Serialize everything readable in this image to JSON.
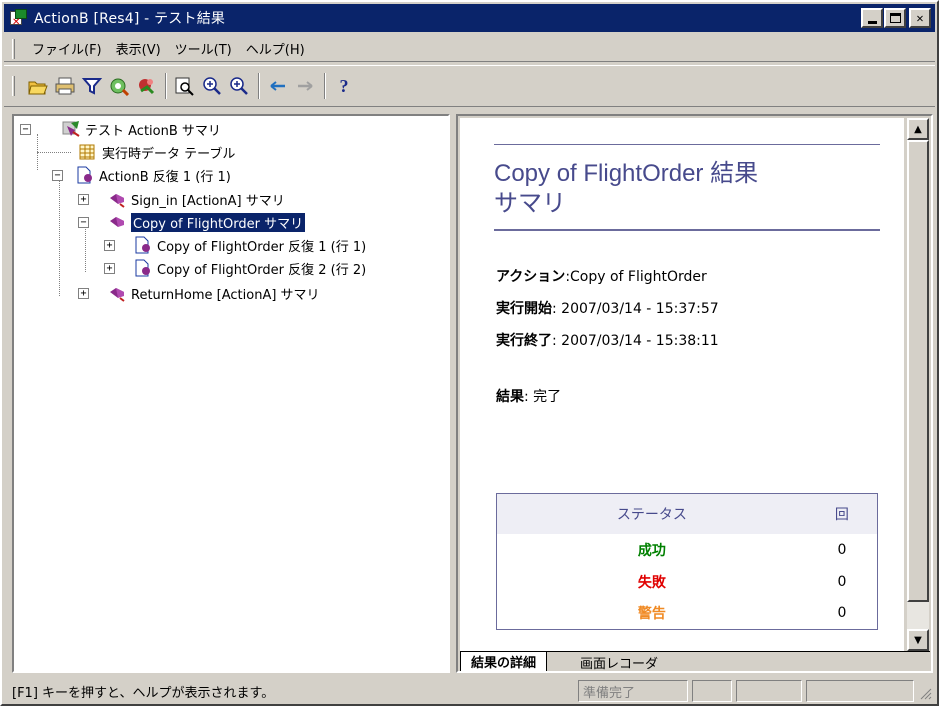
{
  "window": {
    "title": "ActionB [Res4] - テスト結果"
  },
  "menu": [
    "ファイル(F)",
    "表示(V)",
    "ツール(T)",
    "ヘルプ(H)"
  ],
  "toolbar": {
    "buttons": [
      "open-icon",
      "print-icon",
      "filter-icon",
      "find-icon",
      "remove-icon",
      "zoom-page-icon",
      "zoom-in-icon",
      "zoom-out-icon",
      "back-arrow-icon",
      "forward-arrow-icon",
      "help-icon"
    ],
    "help_label": "?"
  },
  "tree": {
    "root": "テスト ActionB サマリ",
    "data_table": "実行時データ テーブル",
    "iteration": "ActionB 反復 1 (行 1)",
    "sign_in": "Sign_in [ActionA] サマリ",
    "copy_order": "Copy of FlightOrder サマリ",
    "copy_iter1": "Copy of FlightOrder 反復 1 (行 1)",
    "copy_iter2": "Copy of FlightOrder 反復 2 (行 2)",
    "return_home": "ReturnHome [ActionA] サマリ"
  },
  "report": {
    "title_line1": "Copy of FlightOrder 結果",
    "title_line2": "サマリ",
    "action_label": "アクション",
    "action_value": ":Copy of FlightOrder",
    "start_label": "実行開始",
    "start_value": ": 2007/03/14 - 15:37:57",
    "end_label": "実行終了",
    "end_value": ": 2007/03/14 - 15:38:11",
    "result_label": "結果",
    "result_value": ": 完了",
    "table_headers": [
      "ステータス",
      "回"
    ],
    "table_rows": [
      {
        "status": "成功",
        "count": "0",
        "color": "#008000"
      },
      {
        "status": "失敗",
        "count": "0",
        "color": "#e00000"
      },
      {
        "status": "警告",
        "count": "0",
        "color": "#f08a24"
      }
    ]
  },
  "tabs": {
    "details": "結果の詳細",
    "recorder": "画面レコーダ"
  },
  "status": {
    "help_text": "[F1] キーを押すと、ヘルプが表示されます。",
    "ready": "準備完了"
  }
}
